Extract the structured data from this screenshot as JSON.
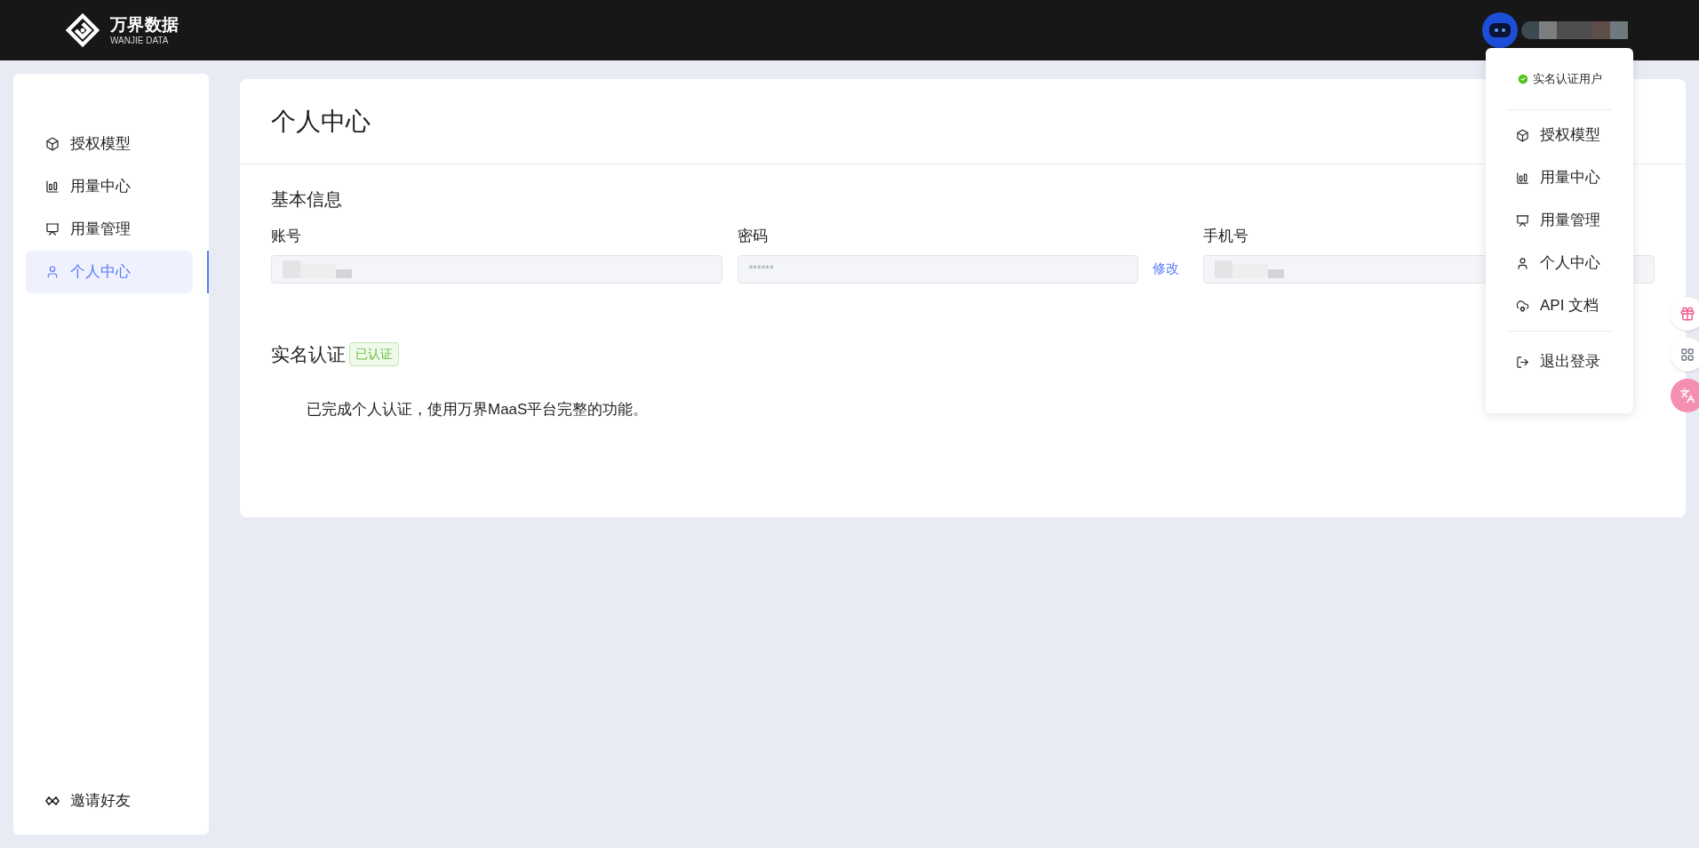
{
  "header": {
    "logo_title": "万界数据",
    "logo_subtitle": "WANJIE DATA"
  },
  "sidebar": {
    "items": [
      {
        "label": "授权模型",
        "selected": false
      },
      {
        "label": "用量中心",
        "selected": false
      },
      {
        "label": "用量管理",
        "selected": false
      },
      {
        "label": "个人中心",
        "selected": true
      }
    ],
    "footer_item": {
      "label": "邀请好友"
    }
  },
  "page": {
    "title": "个人中心",
    "basic_info": {
      "heading": "基本信息",
      "fields": [
        {
          "label": "账号",
          "kind": "redacted"
        },
        {
          "label": "密码",
          "kind": "password",
          "value": "******",
          "action": "修改"
        },
        {
          "label": "手机号",
          "kind": "redacted"
        }
      ]
    },
    "verification": {
      "heading": "实名认证",
      "badge": "已认证",
      "message": "已完成个人认证，使用万界MaaS平台完整的功能。"
    }
  },
  "user_menu": {
    "status": "实名认证用户",
    "verified": true,
    "items": [
      {
        "label": "授权模型"
      },
      {
        "label": "用量中心"
      },
      {
        "label": "用量管理"
      },
      {
        "label": "个人中心"
      },
      {
        "label": "API 文档"
      }
    ],
    "logout": {
      "label": "退出登录"
    }
  }
}
